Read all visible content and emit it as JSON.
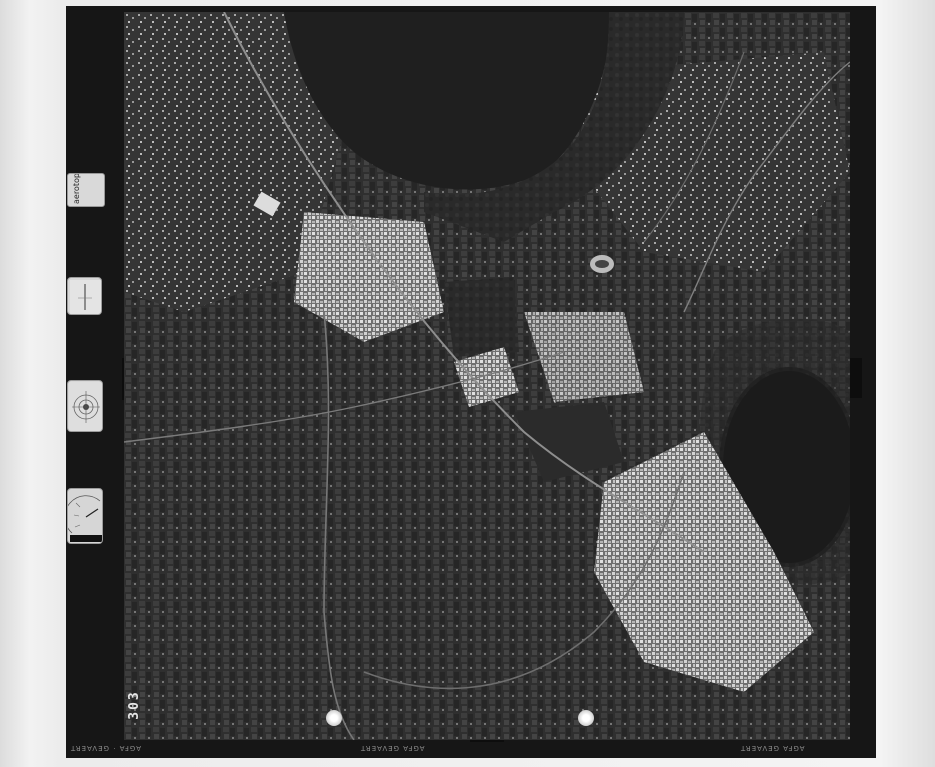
{
  "frame_number": "303",
  "brand_label": "aerotop",
  "film_edge": {
    "bottom_left": "AGFA · GEVAERT",
    "bottom_center": "AGFA  GEVAERT",
    "bottom_right": "AGFA  GEVAERT"
  },
  "colors": {
    "film": "#161616",
    "water": "#1e1e1e",
    "urban": "#b9b9b9",
    "vegetation": "#3a3a3a"
  },
  "icons": [
    "altimeter-gauge-icon",
    "level-bubble-icon",
    "clock-gauge-icon",
    "fiducial-mark-icon"
  ]
}
